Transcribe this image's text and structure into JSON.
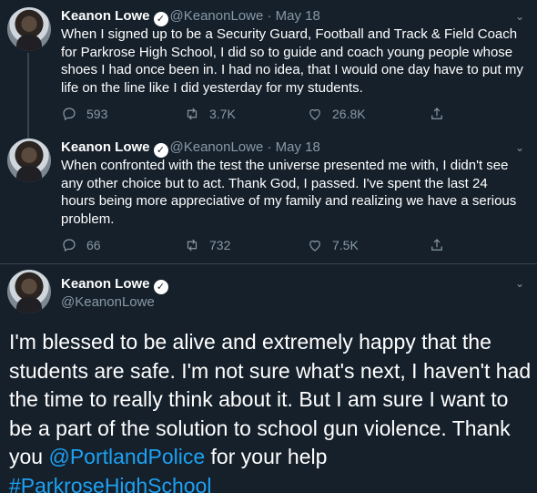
{
  "tweets": [
    {
      "name": "Keanon Lowe",
      "handle": "@KeanonLowe",
      "date": "May 18",
      "text": "When I signed up to be a Security Guard, Football and Track & Field Coach for Parkrose High School, I did so to guide and coach young people whose shoes I had once been in. I had no idea, that I would one day have to put my life on the line like I did yesterday for my students.",
      "replies": "593",
      "retweets": "3.7K",
      "likes": "26.8K"
    },
    {
      "name": "Keanon Lowe",
      "handle": "@KeanonLowe",
      "date": "May 18",
      "text": "When confronted with the test the universe presented me with, I didn't see any other choice but to act. Thank God, I passed. I've spent the last 24 hours being more appreciative of my family and realizing we have a serious problem.",
      "replies": "66",
      "retweets": "732",
      "likes": "7.5K"
    }
  ],
  "main_tweet": {
    "name": "Keanon Lowe",
    "handle": "@KeanonLowe",
    "text_part1": "I'm blessed to be alive and extremely happy that the students are safe. I'm not sure what's next, I haven't had the time to really think about it. But I am sure I want to be a part of the solution to school gun violence. Thank you ",
    "mention": "@PortlandPolice",
    "text_part2": " for your help ",
    "hashtag": "#ParkroseHighSchool"
  },
  "icons": {
    "verified": "verified-badge-icon",
    "reply": "reply-icon",
    "retweet": "retweet-icon",
    "like": "heart-icon",
    "share": "share-icon",
    "more": "chevron-down-icon"
  },
  "colors": {
    "background": "#15202b",
    "muted": "#8899a6",
    "link": "#1da1f2",
    "divider": "#38444d"
  }
}
